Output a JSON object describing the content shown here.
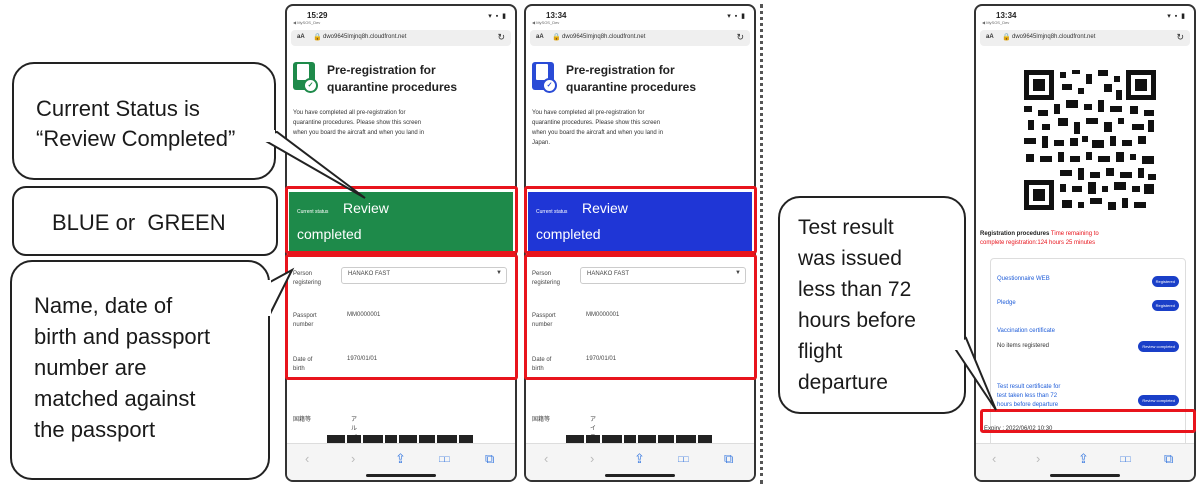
{
  "callouts": {
    "status": [
      "Current Status is",
      "“Review Completed”"
    ],
    "color": "BLUE or  GREEN",
    "identity": [
      "Name, date of",
      "birth and passport",
      "number are",
      "matched against",
      "the passport"
    ],
    "test": [
      "Test result",
      "was issued",
      "less than 72",
      "hours before",
      "flight",
      "departure"
    ]
  },
  "phones": [
    {
      "time": "15:29",
      "carrier": "◀ MySOS_Dev",
      "status_icons": "▾ ▪ ▮",
      "url_aa": "aA",
      "url": "dwo9645lmjnq8h.cloudfront.net",
      "reload": "↻",
      "title_line1": "Pre-registration for",
      "title_line2": "quarantine procedures",
      "intro": [
        "You have completed all pre-registration for",
        "quarantine procedures. Please show this screen",
        "when you board the aircraft and when you land in"
      ],
      "status_label": "Current status",
      "status_value1": "Review",
      "status_value2": "completed",
      "status_color": "#1e8a4a",
      "icon_color": "#1e8a4a",
      "person_label": [
        "Person",
        "registering"
      ],
      "person_value": "HANAKO FAST",
      "passport_label": [
        "Passport",
        "number"
      ],
      "passport_value": "MM0000001",
      "dob_label": [
        "Date of",
        "birth"
      ],
      "dob_value": "1970/01/01",
      "nationality_label": "国籍等",
      "nationality_value": "アルバニア"
    },
    {
      "time": "13:34",
      "carrier": "◀ MySOS_Dev",
      "status_icons": "▾ ▪ ▮",
      "url_aa": "aA",
      "url": "dwo9645lmjnq8h.cloudfront.net",
      "reload": "↻",
      "title_line1": "Pre-registration for",
      "title_line2": "quarantine procedures",
      "intro": [
        "You have completed all pre-registration for",
        "quarantine procedures. Please show this screen",
        "when you board the aircraft and when you land in",
        "Japan."
      ],
      "status_label": "Current status",
      "status_value1": "Review",
      "status_value2": "completed",
      "status_color": "#1f36d6",
      "icon_color": "#2a4bd6",
      "person_label": [
        "Person",
        "registering"
      ],
      "person_value": "HANAKO FAST",
      "passport_label": [
        "Passport",
        "number"
      ],
      "passport_value": "MM0000001",
      "dob_label": [
        "Date of",
        "birth"
      ],
      "dob_value": "1970/01/01",
      "nationality_label": "国籍等",
      "nationality_value": "アイスランド"
    },
    {
      "time": "13:34",
      "carrier": "◀ MySOS_Dev",
      "status_icons": "▾ ▪ ▮",
      "url_aa": "aA",
      "url": "dwo9645lmjnq8h.cloudfront.net",
      "reload": "↻",
      "reg_title": "Registration procedures",
      "reg_time": "Time remaining to",
      "reg_time2": "complete registration:124 hours 25 minutes",
      "items": [
        {
          "name": "Questionnaire WEB",
          "badge": "Registered"
        },
        {
          "name": "Pledge",
          "badge": "Registered"
        },
        {
          "name": "Vaccination certificate",
          "sub": "No items registered",
          "badge": "Review completed"
        },
        {
          "name": [
            "Test result certificate for",
            "test taken less than 72",
            "hours before departure"
          ],
          "badge": "Review completed"
        }
      ],
      "expiry": "Expiry : 2022/06/02 10:30"
    }
  ],
  "toolbar": {
    "back": "‹",
    "forward": "›",
    "share": "⇪",
    "bookmarks": "□□",
    "tabs": "⧉"
  }
}
